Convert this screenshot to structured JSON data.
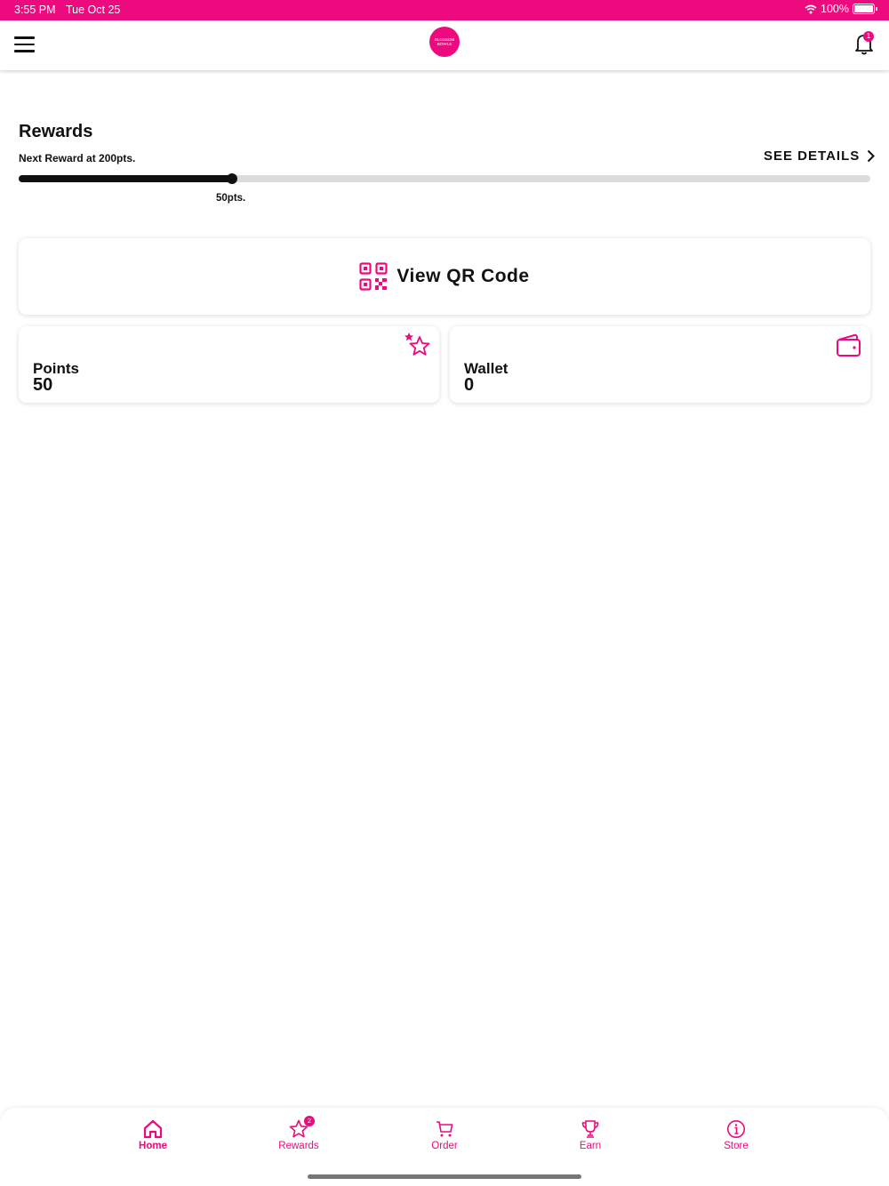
{
  "status_bar": {
    "time": "3:55 PM",
    "date": "Tue Oct 25",
    "battery": "100%"
  },
  "header": {
    "logo_line1": "BLOSSOM",
    "logo_line2": "BOWLS",
    "notification_count": "1"
  },
  "rewards": {
    "title": "Rewards",
    "next_reward": "Next Reward at 200pts.",
    "see_details": "SEE DETAILS",
    "current_points_label": "50pts.",
    "progress": 0.25
  },
  "qr": {
    "label": "View QR Code"
  },
  "points": {
    "label": "Points",
    "value": "50"
  },
  "wallet": {
    "label": "Wallet",
    "value": "0"
  },
  "tabs": [
    {
      "label": "Home",
      "icon": "home-icon",
      "active": true
    },
    {
      "label": "Rewards",
      "icon": "star-icon",
      "badge": "2"
    },
    {
      "label": "Order",
      "icon": "cart-icon"
    },
    {
      "label": "Earn",
      "icon": "trophy-icon"
    },
    {
      "label": "Store",
      "icon": "info-icon"
    }
  ],
  "colors": {
    "accent": "#ec0a7e",
    "text": "#111111",
    "track": "#dcdcdc"
  }
}
